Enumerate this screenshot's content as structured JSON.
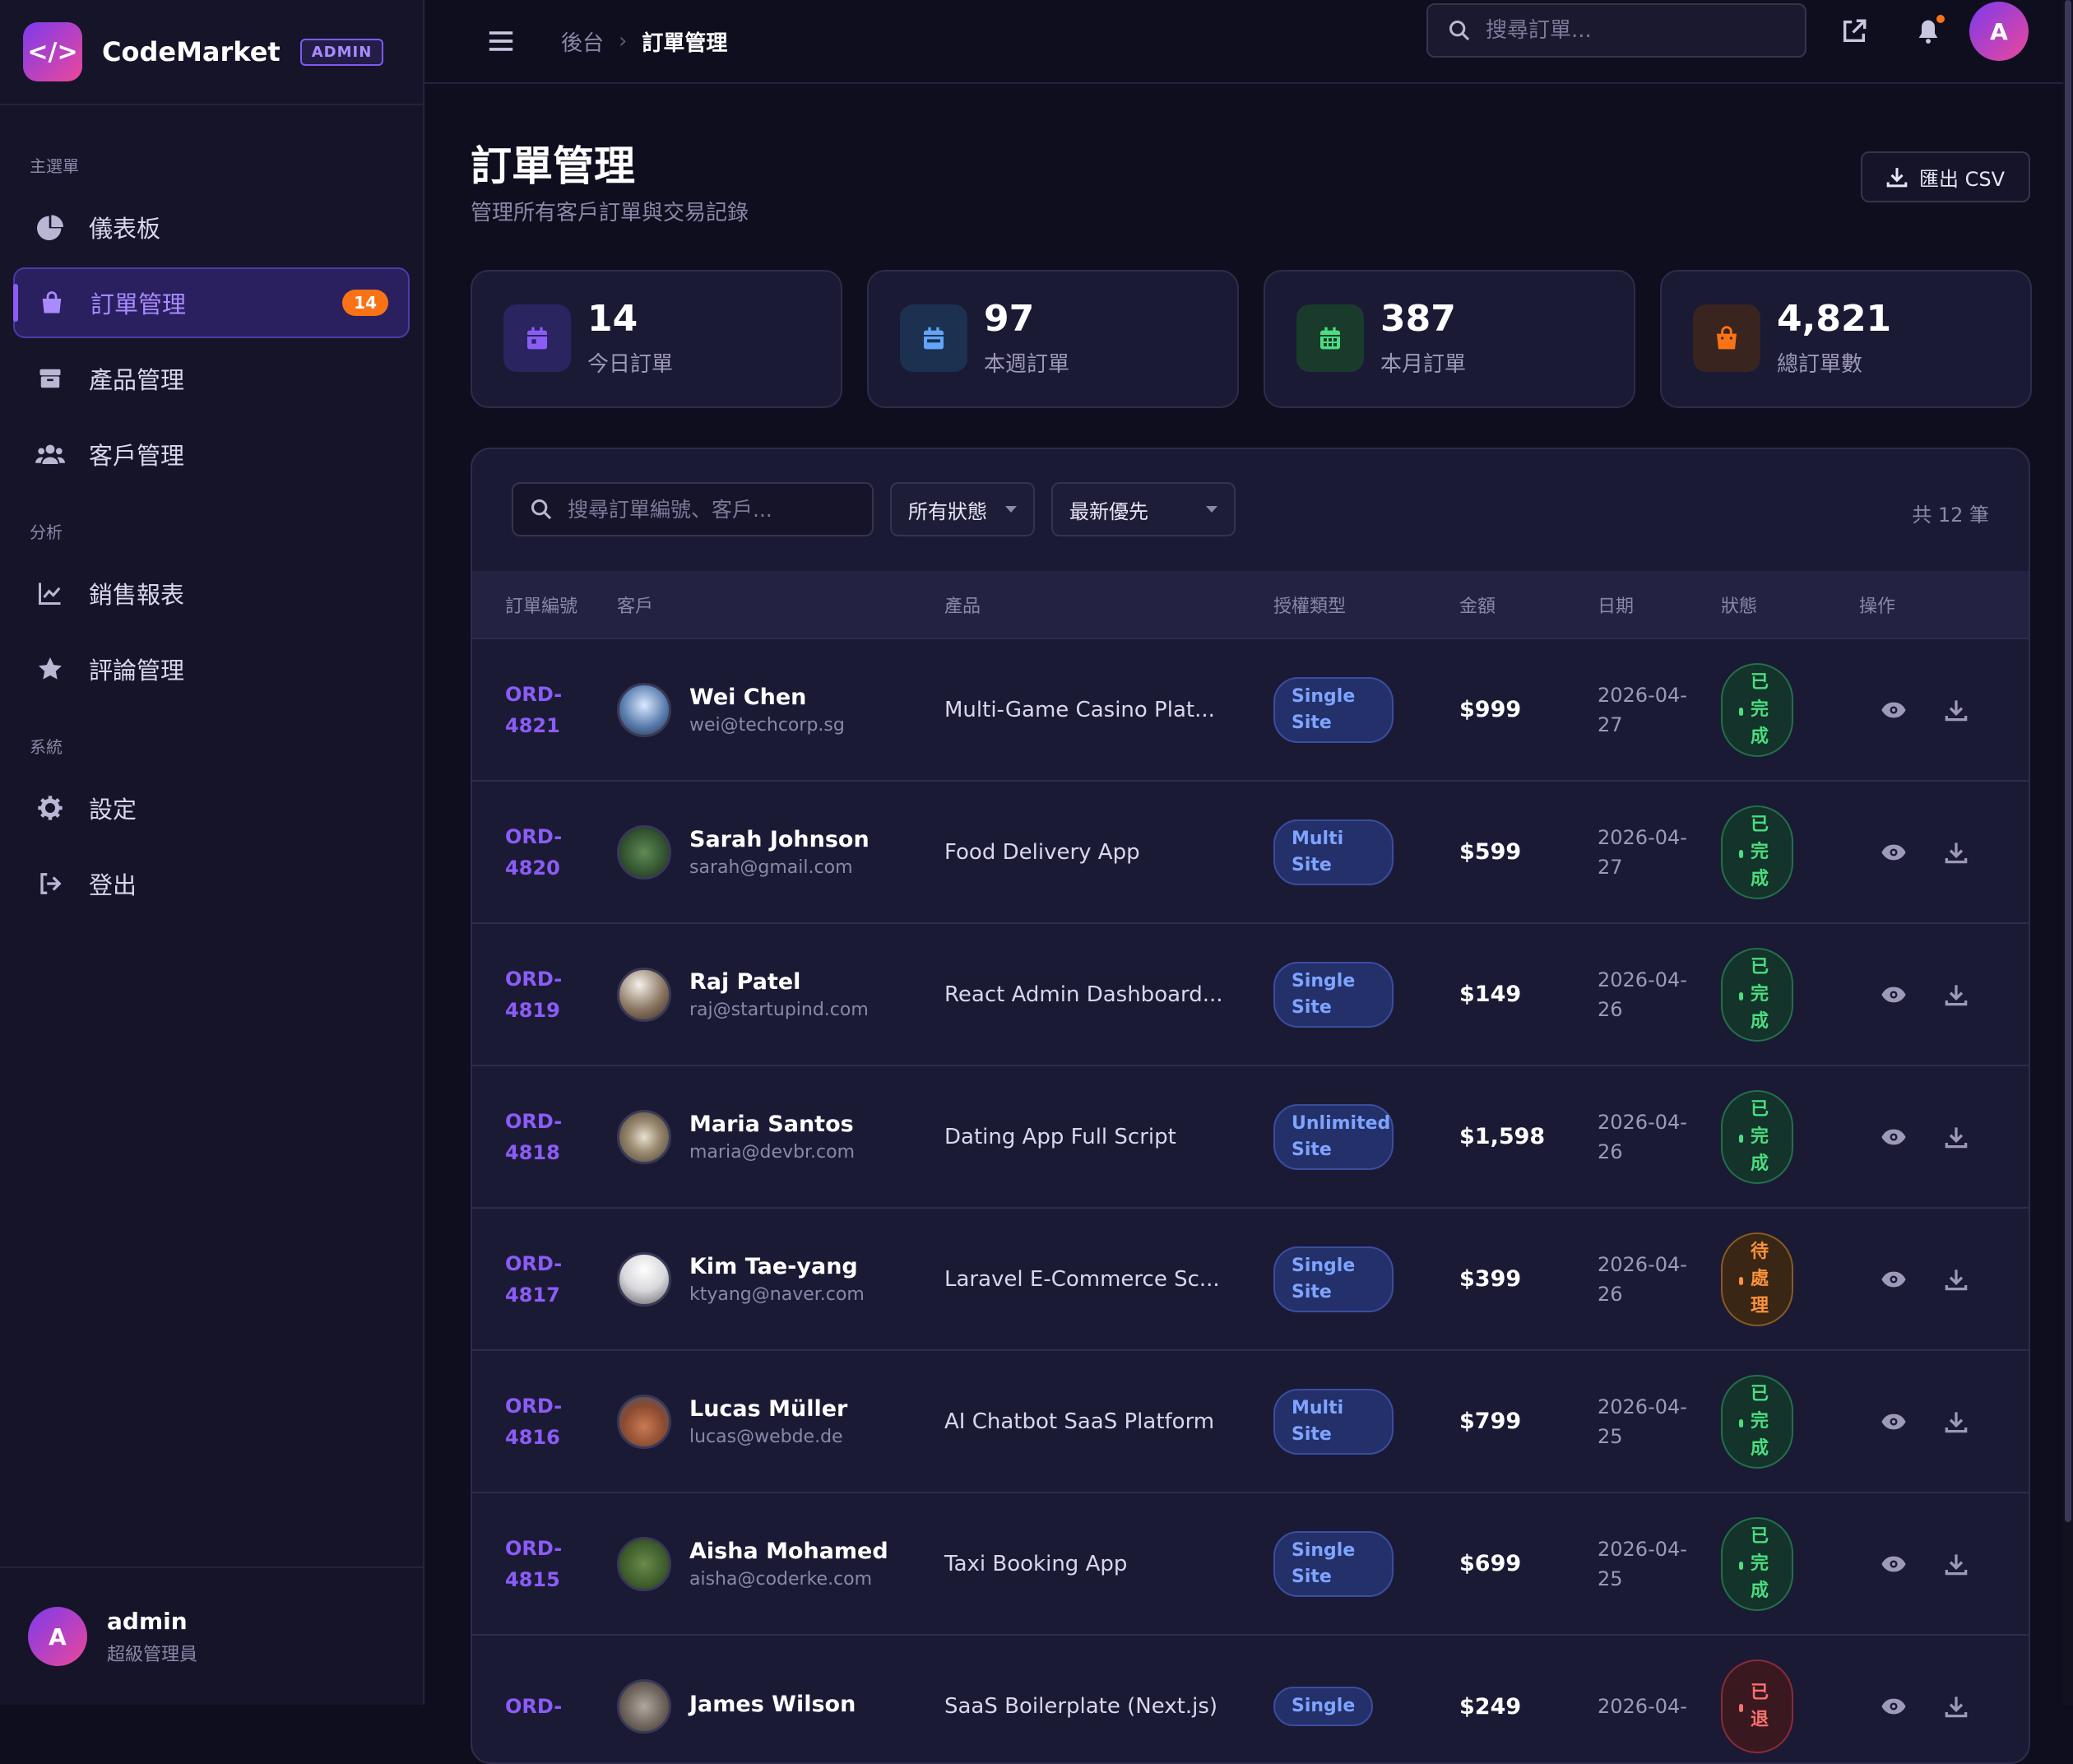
{
  "brand": {
    "name": "CodeMarket",
    "badge": "ADMIN",
    "logo": "</>"
  },
  "sidebar": {
    "sections": [
      "主選單",
      "分析",
      "系統"
    ],
    "items": [
      {
        "label": "儀表板",
        "icon": "pie-chart-icon"
      },
      {
        "label": "訂單管理",
        "icon": "shopping-bag-icon",
        "badge": "14",
        "active": true
      },
      {
        "label": "產品管理",
        "icon": "box-icon"
      },
      {
        "label": "客戶管理",
        "icon": "users-icon"
      },
      {
        "label": "銷售報表",
        "icon": "line-chart-icon"
      },
      {
        "label": "評論管理",
        "icon": "star-icon"
      },
      {
        "label": "設定",
        "icon": "gear-icon"
      },
      {
        "label": "登出",
        "icon": "logout-icon"
      }
    ],
    "user": {
      "initial": "A",
      "name": "admin",
      "role": "超級管理員"
    }
  },
  "topbar": {
    "breadcrumb_root": "後台",
    "breadcrumb_current": "訂單管理",
    "search_placeholder": "搜尋訂單...",
    "avatar_initial": "A"
  },
  "page": {
    "title": "訂單管理",
    "subtitle": "管理所有客戶訂單與交易記錄",
    "export_label": "匯出 CSV"
  },
  "stats": [
    {
      "value": "14",
      "label": "今日訂單",
      "icon": "calendar-day-icon",
      "color": "#8b5cf6"
    },
    {
      "value": "97",
      "label": "本週訂單",
      "icon": "calendar-week-icon",
      "color": "#60a5fa"
    },
    {
      "value": "387",
      "label": "本月訂單",
      "icon": "calendar-month-icon",
      "color": "#4ade80"
    },
    {
      "value": "4,821",
      "label": "總訂單數",
      "icon": "shopping-bag-icon",
      "color": "#f97316"
    }
  ],
  "filters": {
    "search_placeholder": "搜尋訂單編號、客戶...",
    "status_selected": "所有狀態",
    "sort_selected": "最新優先",
    "total": "共 12 筆"
  },
  "table": {
    "headers": [
      "訂單編號",
      "客戶",
      "產品",
      "授權類型",
      "金額",
      "日期",
      "狀態",
      "操作"
    ],
    "rows": [
      {
        "id": "ORD-4821",
        "name": "Wei Chen",
        "email": "wei@techcorp.sg",
        "product": "Multi-Game Casino Plat...",
        "license": "Single Site",
        "amount": "$999",
        "date": "2026-04-27",
        "status": "已完成",
        "status_type": "done"
      },
      {
        "id": "ORD-4820",
        "name": "Sarah Johnson",
        "email": "sarah@gmail.com",
        "product": "Food Delivery App",
        "license": "Multi Site",
        "amount": "$599",
        "date": "2026-04-27",
        "status": "已完成",
        "status_type": "done"
      },
      {
        "id": "ORD-4819",
        "name": "Raj Patel",
        "email": "raj@startupind.com",
        "product": "React Admin Dashboard...",
        "license": "Single Site",
        "amount": "$149",
        "date": "2026-04-26",
        "status": "已完成",
        "status_type": "done"
      },
      {
        "id": "ORD-4818",
        "name": "Maria Santos",
        "email": "maria@devbr.com",
        "product": "Dating App Full Script",
        "license": "Unlimited Site",
        "amount": "$1,598",
        "date": "2026-04-26",
        "status": "已完成",
        "status_type": "done"
      },
      {
        "id": "ORD-4817",
        "name": "Kim Tae-yang",
        "email": "ktyang@naver.com",
        "product": "Laravel E-Commerce Sc...",
        "license": "Single Site",
        "amount": "$399",
        "date": "2026-04-26",
        "status": "待處理",
        "status_type": "pending"
      },
      {
        "id": "ORD-4816",
        "name": "Lucas Müller",
        "email": "lucas@webde.de",
        "product": "AI Chatbot SaaS Platform",
        "license": "Multi Site",
        "amount": "$799",
        "date": "2026-04-25",
        "status": "已完成",
        "status_type": "done"
      },
      {
        "id": "ORD-4815",
        "name": "Aisha Mohamed",
        "email": "aisha@coderke.com",
        "product": "Taxi Booking App",
        "license": "Single Site",
        "amount": "$699",
        "date": "2026-04-25",
        "status": "已完成",
        "status_type": "done"
      },
      {
        "id": "ORD-",
        "name": "James Wilson",
        "email": "",
        "product": "SaaS Boilerplate (Next.js)",
        "license": "Single",
        "amount": "$249",
        "date": "2026-04-",
        "status": "已退",
        "status_type": "refund"
      }
    ]
  },
  "colors": {
    "accent": "#8b5cf6",
    "background": "#0f0e1f",
    "panel": "#1b1a35"
  }
}
